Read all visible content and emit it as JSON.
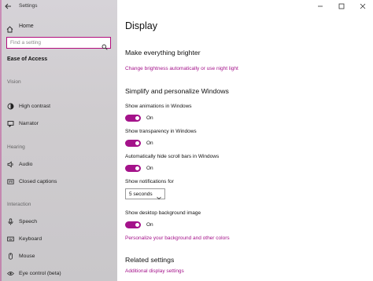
{
  "app": {
    "title": "Settings"
  },
  "sidebar": {
    "home_label": "Home",
    "search_placeholder": "Find a setting",
    "section_title": "Ease of Access",
    "groups": [
      {
        "label": "Vision",
        "items": [
          {
            "label": "High contrast",
            "icon": "contrast-icon"
          },
          {
            "label": "Narrator",
            "icon": "narrator-icon"
          }
        ]
      },
      {
        "label": "Hearing",
        "items": [
          {
            "label": "Audio",
            "icon": "speaker-icon"
          },
          {
            "label": "Closed captions",
            "icon": "captions-icon"
          }
        ]
      },
      {
        "label": "Interaction",
        "items": [
          {
            "label": "Speech",
            "icon": "microphone-icon"
          },
          {
            "label": "Keyboard",
            "icon": "keyboard-icon"
          },
          {
            "label": "Mouse",
            "icon": "mouse-icon"
          },
          {
            "label": "Eye control (beta)",
            "icon": "eye-icon"
          }
        ]
      }
    ]
  },
  "content": {
    "title": "Display",
    "brighter": {
      "heading": "Make everything brighter",
      "link": "Change brightness automatically or use night light"
    },
    "simplify": {
      "heading": "Simplify and personalize Windows",
      "animations": {
        "label": "Show animations in Windows",
        "state": "On"
      },
      "transparency": {
        "label": "Show transparency in Windows",
        "state": "On"
      },
      "scrollbars": {
        "label": "Automatically hide scroll bars in Windows",
        "state": "On"
      },
      "notifications": {
        "label": "Show notifications for",
        "value": "5 seconds"
      },
      "background": {
        "label": "Show desktop background image",
        "state": "On"
      },
      "personalize_link": "Personalize your background and other colors"
    },
    "related": {
      "heading": "Related settings",
      "link": "Additional display settings"
    }
  },
  "colors": {
    "accent": "#a4128a",
    "search_border": "#b30d7d"
  }
}
